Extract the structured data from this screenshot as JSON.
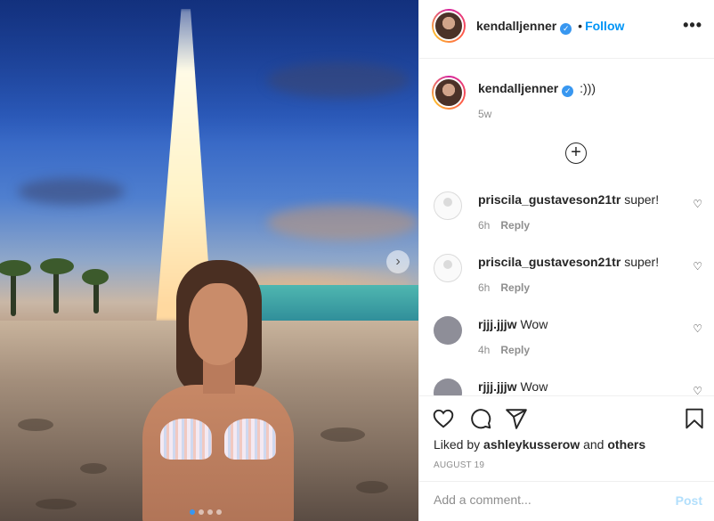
{
  "post": {
    "author": "kendalljenner",
    "follow_label": "Follow",
    "more_label": "•••",
    "caption": ":)))",
    "caption_time": "5w",
    "load_more": "+"
  },
  "carousel": {
    "next_label": "›",
    "slide_count": 4,
    "active_slide": 1
  },
  "comments": [
    {
      "user": "priscila_gustaveson21tr",
      "text": "super!",
      "time": "6h",
      "reply_label": "Reply",
      "avatar": "blank"
    },
    {
      "user": "priscila_gustaveson21tr",
      "text": "super!",
      "time": "6h",
      "reply_label": "Reply",
      "avatar": "blank"
    },
    {
      "user": "rjjj.jjjw",
      "text": "Wow",
      "time": "4h",
      "reply_label": "Reply",
      "avatar": "gray"
    },
    {
      "user": "rjjj.jjjw",
      "text": "Wow",
      "time": "",
      "reply_label": "",
      "avatar": "gray"
    }
  ],
  "actions": {
    "liked_by_prefix": "Liked by",
    "liked_by_user": "ashleykusserow",
    "liked_by_and": "and",
    "liked_by_others": "others",
    "date": "AUGUST 19"
  },
  "add_comment": {
    "placeholder": "Add a comment...",
    "post_label": "Post"
  },
  "colors": {
    "accent": "#0095f6",
    "post_disabled": "#b2dffc",
    "muted": "#8e8e8e",
    "border": "#efefef"
  }
}
